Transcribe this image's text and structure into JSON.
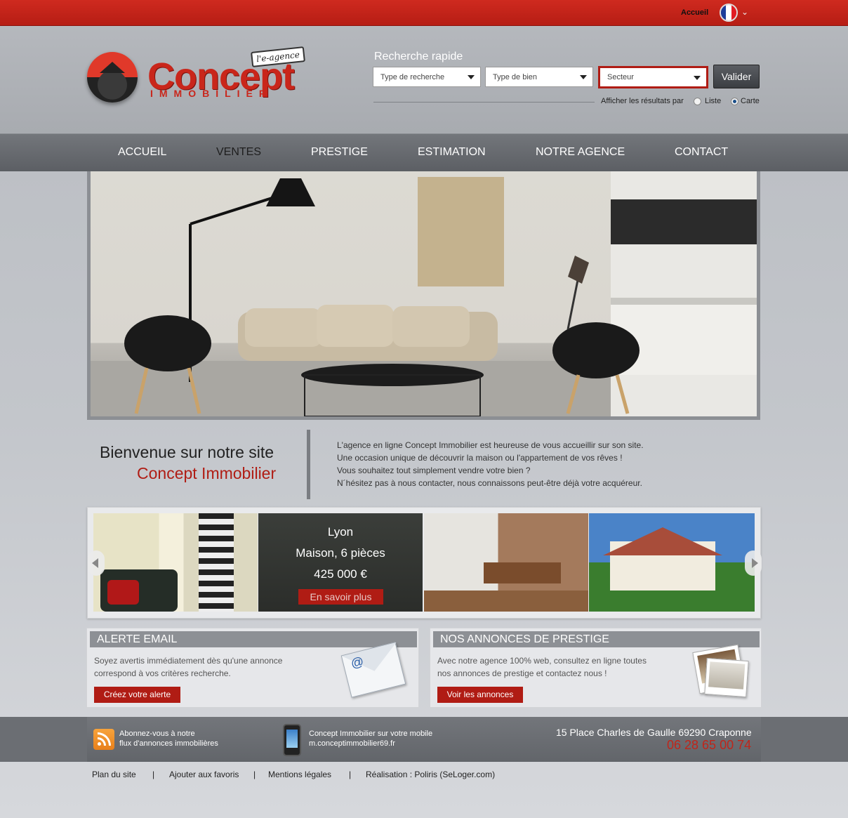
{
  "topbar": {
    "link": "Accueil",
    "flag_colors": [
      "#1d3d9a",
      "#ffffff",
      "#e21b22"
    ]
  },
  "logo": {
    "tag": "l'e-agence",
    "name": "Concept",
    "sub": "IMMOBILIER"
  },
  "search": {
    "title": "Recherche rapide",
    "type_recherche": "Type de recherche",
    "type_bien": "Type de bien",
    "secteur": "Secteur",
    "submit": "Valider",
    "afficher_label": "Afficher les résultats par",
    "opt_liste": "Liste",
    "opt_carte": "Carte",
    "selected": "Carte"
  },
  "nav": [
    "ACCUEIL",
    "VENTES",
    "PRESTIGE",
    "ESTIMATION",
    "NOTRE AGENCE",
    "CONTACT"
  ],
  "welcome": {
    "line1": "Bienvenue sur notre site",
    "line2": "Concept Immobilier",
    "paragraphs": [
      "L'agence en ligne Concept Immobilier est heureuse de vous accueillir sur son site.",
      "Une occasion unique de découvrir la maison ou l'appartement de vos rêves !",
      "Vous souhaitez tout simplement vendre votre bien ?",
      "N´hésitez pas à nous contacter, nous connaissons peut-être déjà votre acquéreur."
    ]
  },
  "carousel": {
    "city": "Lyon",
    "type": "Maison, 6 pièces",
    "price": "425 000 €",
    "more": "En savoir plus"
  },
  "alerte": {
    "title": "ALERTE EMAIL",
    "text1": "Soyez avertis immédiatement dès qu'une annonce",
    "text2": "correspond à vos critères recherche.",
    "button": "Créez votre alerte"
  },
  "prestige": {
    "title": "NOS ANNONCES DE PRESTIGE",
    "text1": "Avec notre agence 100% web, consultez en ligne toutes",
    "text2": "nos annonces de prestige et contactez nous !",
    "button": "Voir les annonces"
  },
  "footer": {
    "rss1": "Abonnez-vous à notre",
    "rss2": "flux d'annonces immobilières",
    "mobile1": "Concept Immobilier sur votre mobile",
    "mobile2": "m.conceptimmobilier69.fr",
    "address": "15 Place Charles de Gaulle 69290 Craponne",
    "phone": "06 28 65 00 74"
  },
  "bottom_links": [
    "Plan du site",
    "|",
    "Ajouter aux favoris",
    "|",
    "Mentions légales",
    "|",
    "Réalisation : Poliris (SeLoger.com)"
  ]
}
